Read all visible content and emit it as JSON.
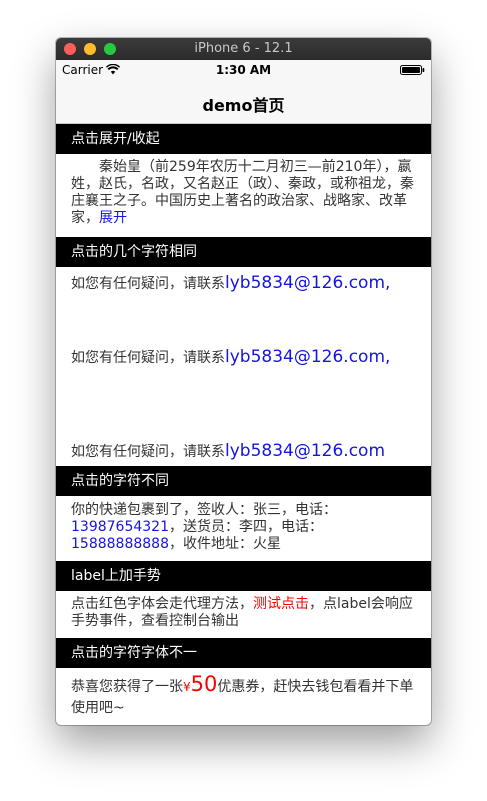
{
  "window": {
    "title": "iPhone 6 - 12.1"
  },
  "status_bar": {
    "carrier": "Carrier",
    "time": "1:30 AM",
    "wifi_icon": "wifi-icon",
    "battery_icon": "battery-icon"
  },
  "nav": {
    "title": "demo首页"
  },
  "sections": [
    {
      "header": "点击展开/收起",
      "text": "秦始皇（前259年农历十二月初三—前210年），嬴姓，赵氏，名政，又名赵正（政）、秦政，或称祖龙，秦庄襄王之子。中国历史上著名的政治家、战略家、改革家，",
      "link": "展开"
    },
    {
      "header": "点击的几个字符相同",
      "items": [
        {
          "prefix": "如您有任何疑问，请联系",
          "email": "lyb5834@126.com",
          "suffix": ","
        },
        {
          "prefix": "如您有任何疑问，请联系",
          "email": "lyb5834@126.com",
          "suffix": ","
        },
        {
          "prefix": "如您有任何疑问，请联系",
          "email": "lyb5834@126.com",
          "suffix": ""
        }
      ]
    },
    {
      "header": "点击的字符不同",
      "parts": {
        "a": "你的快递包裹到了，签收人：张三，电话：",
        "phone1": "13987654321",
        "b": "，送货员：李四，电话：",
        "phone2": "15888888888",
        "c": "，收件地址：火星"
      }
    },
    {
      "header": "label上加手势",
      "parts": {
        "a": "点击红色字体会走代理方法，",
        "red": "测试点击",
        "b": "，点label会响应手势事件，查看控制台输出"
      }
    },
    {
      "header": "点击的字符字体不一",
      "parts": {
        "a": "恭喜您获得了一张",
        "yen": "¥",
        "amount": "50",
        "b": "优惠券，赶快去钱包看看并下单使用吧~"
      }
    }
  ],
  "colors": {
    "link": "#1515e0",
    "highlight": "#ff0000",
    "header_bg": "#000000"
  }
}
